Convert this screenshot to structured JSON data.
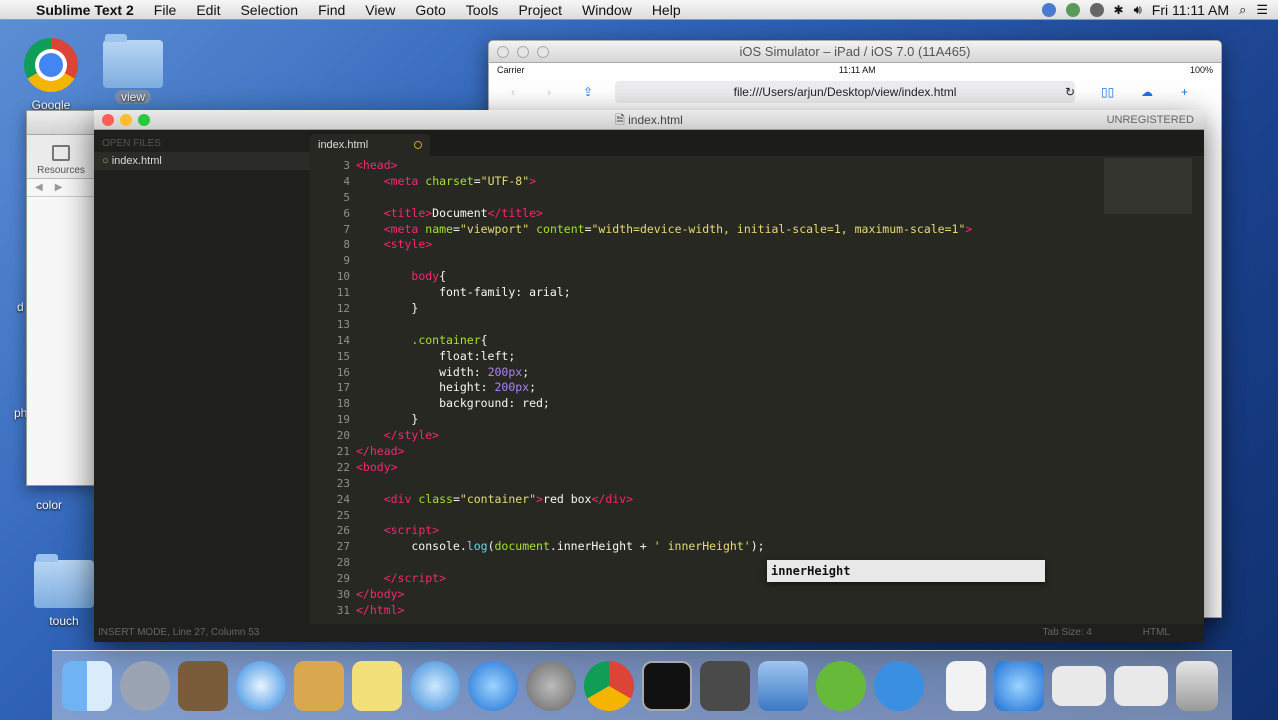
{
  "menubar": {
    "app": "Sublime Text 2",
    "items": [
      "File",
      "Edit",
      "Selection",
      "Find",
      "View",
      "Goto",
      "Tools",
      "Project",
      "Window",
      "Help"
    ],
    "clock": "Fri 11:11 AM"
  },
  "desktop": {
    "icons": [
      "Google",
      "view",
      "Resources",
      "color",
      "touch"
    ],
    "partial_labels": [
      "d",
      "ph"
    ]
  },
  "simulator": {
    "title": "iOS Simulator – iPad / iOS 7.0 (11A465)",
    "carrier": "Carrier",
    "time": "11:11 AM",
    "battery": "100%",
    "url": "file:///Users/arjun/Desktop/view/index.html"
  },
  "sublime": {
    "title": "index.html",
    "unregistered": "UNREGISTERED",
    "sidebar_header": "OPEN FILES",
    "open_file": "index.html",
    "tab": "index.html",
    "line_numbers": [
      "3",
      "4",
      "5",
      "6",
      "7",
      "8",
      "9",
      "10",
      "11",
      "12",
      "13",
      "14",
      "15",
      "16",
      "17",
      "18",
      "19",
      "20",
      "21",
      "22",
      "23",
      "24",
      "25",
      "26",
      "27",
      "28",
      "29",
      "30",
      "31"
    ],
    "autocomplete": "innerHeight",
    "status": "INSERT MODE, Line 27, Column 53",
    "tab_size": "Tab Size: 4",
    "syntax": "HTML"
  },
  "dock": {
    "items": [
      "Finder",
      "Launchpad",
      "Preview",
      "Safari",
      "Contacts",
      "Stickies",
      "iTunes",
      "App Store",
      "System Preferences",
      "Chrome",
      "Terminal",
      "Sublime Text",
      "Xcode",
      "uTorrent",
      "Edge",
      "HTML",
      "App Store",
      "Window",
      "Window",
      "Trash"
    ]
  }
}
